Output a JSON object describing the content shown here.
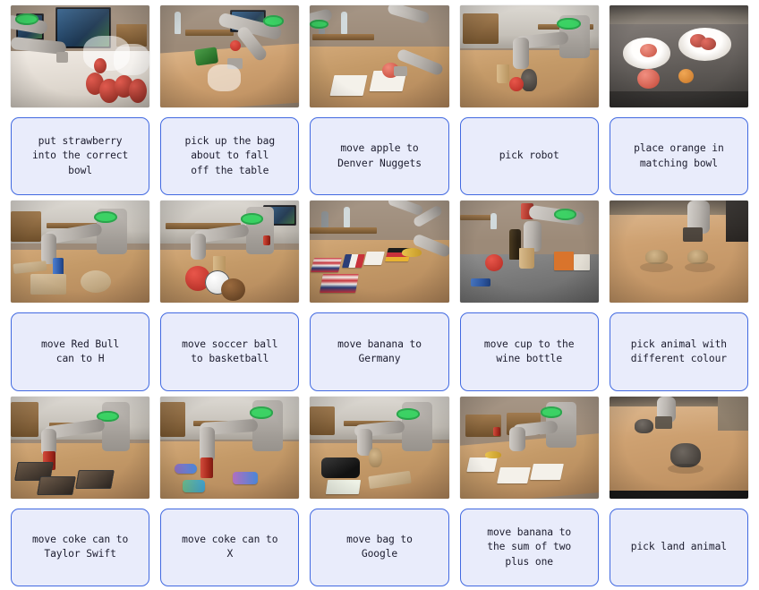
{
  "page": {
    "title": "Robot Manipulation Task Instruction Grid",
    "grid": {
      "rows": 3,
      "columns": 5
    },
    "caption_border_color": "#4169e1",
    "caption_fill_color": "#e9ecfb",
    "caption_text_color": "#1c1c2e",
    "background_color": "#ffffff"
  },
  "cells": [
    {
      "index": 1,
      "row": 1,
      "column": 1,
      "caption": "put strawberry\ninto the correct\nbowl",
      "scene": "robot arm in white-covered workspace with plastic bags, a monitor on the back wall and a pile of red strawberries in the foreground"
    },
    {
      "index": 2,
      "row": 1,
      "column": 2,
      "caption": "pick up the bag\nabout to fall\noff the table",
      "scene": "robot arm reaching over a wooden table edge toward a green snack bag and a white bag hanging off the table"
    },
    {
      "index": 3,
      "row": 1,
      "column": 3,
      "caption": "move apple to\nDenver Nuggets",
      "scene": "robot gripper holding a red apple above printed logo cards laid on a wooden table"
    },
    {
      "index": 4,
      "row": 1,
      "column": 4,
      "caption": "pick robot",
      "scene": "robot arm above a wooden table holding a small toy robot figure beside a cork cup and a red object"
    },
    {
      "index": 5,
      "row": 1,
      "column": 5,
      "caption": "place orange in\nmatching bowl",
      "scene": "two white bowls on a dark table, one with fruit inside, an apple and an orange resting beside them"
    },
    {
      "index": 6,
      "row": 2,
      "column": 1,
      "caption": "move Red Bull\ncan to H",
      "scene": "robot arm over a wooden table with large wooden letter blocks and a drink can"
    },
    {
      "index": 7,
      "row": 2,
      "column": 2,
      "caption": "move soccer ball\nto basketball",
      "scene": "robot arm behind a wooden table holding a red ball, a white soccer ball and a brown ball"
    },
    {
      "index": 8,
      "row": 2,
      "column": 3,
      "caption": "move banana to\nGermany",
      "scene": "printed national flag cards (United States, France, Germany) arranged on a wooden table with a robot gripper at the right"
    },
    {
      "index": 9,
      "row": 2,
      "column": 4,
      "caption": "move cup to the\nwine bottle",
      "scene": "robot arm above a grey table holding a cup next to a dark wine bottle and a red apple"
    },
    {
      "index": 10,
      "row": 2,
      "column": 5,
      "caption": "pick animal with\ndifferent colour",
      "scene": "robot gripper reaching toward two small tan toy animals on a light wooden floor"
    },
    {
      "index": 11,
      "row": 3,
      "column": 1,
      "caption": "move coke can to\nTaylor Swift",
      "scene": "robot arm holding a coke can over a wooden table with three dark album-cover cards"
    },
    {
      "index": 12,
      "row": 3,
      "column": 2,
      "caption": "move coke can to\nX",
      "scene": "robot arm holding a coke can over a wooden table with colourful scattered logo shapes"
    },
    {
      "index": 13,
      "row": 3,
      "column": 3,
      "caption": "move bag to\nGoogle",
      "scene": "robot arm over a wooden table with a black bag, a printed card and a wooden tray"
    },
    {
      "index": 14,
      "row": 3,
      "column": 4,
      "caption": "move banana to\nthe sum of two\nplus one",
      "scene": "robot arm over a wooden table with a banana and two printed number cards"
    },
    {
      "index": 15,
      "row": 3,
      "column": 5,
      "caption": "pick land animal",
      "scene": "robot gripper above a wooden floor with a small toy cat and a grey toy octopus"
    }
  ]
}
